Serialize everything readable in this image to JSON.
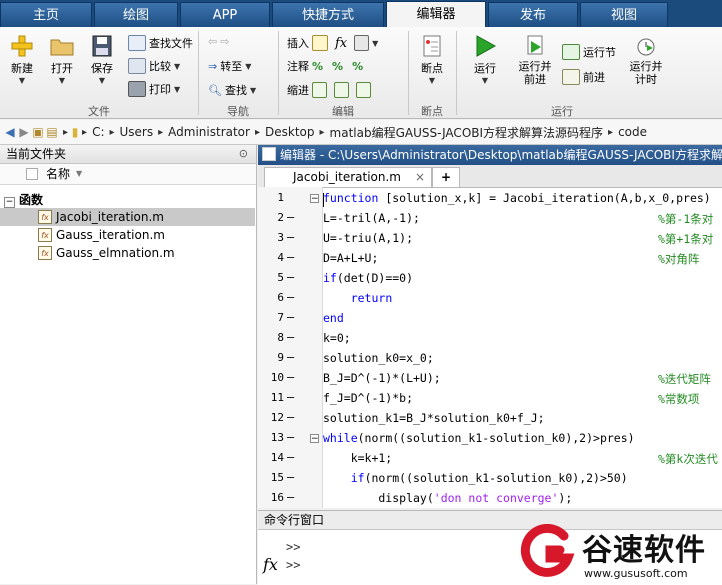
{
  "tabs": [
    "主页",
    "绘图",
    "APP",
    "快捷方式",
    "编辑器",
    "发布",
    "视图"
  ],
  "active_tab": "编辑器",
  "ribbon": {
    "file_group": {
      "label": "文件",
      "new": "新建",
      "open": "打开",
      "save": "保存",
      "find_files": "查找文件",
      "compare": "比较",
      "print": "打印"
    },
    "nav_group": {
      "label": "导航",
      "goto": "转至",
      "find": "查找"
    },
    "edit_group": {
      "label": "编辑",
      "insert": "插入",
      "comment": "注释",
      "indent": "缩进",
      "fx": "fx"
    },
    "breakpoint_group": {
      "label": "断点",
      "breakpoints": "断点"
    },
    "run_group": {
      "label": "运行",
      "run": "运行",
      "run_advance": "运行并\n前进",
      "run_section": "运行节",
      "advance": "前进",
      "run_time": "运行并\n计时"
    }
  },
  "address": [
    "C:",
    "Users",
    "Administrator",
    "Desktop",
    "matlab编程GAUSS-JACOBI方程求解算法源码程序",
    "code"
  ],
  "left_panel": {
    "title": "当前文件夹",
    "column": "名称",
    "group": "函数",
    "files": [
      "Jacobi_iteration.m",
      "Gauss_iteration.m",
      "Gauss_elmnation.m"
    ]
  },
  "editor": {
    "title": "编辑器 - C:\\Users\\Administrator\\Desktop\\matlab编程GAUSS-JACOBI方程求解",
    "tab": "Jacobi_iteration.m",
    "add_tab": "+",
    "lines": [
      {
        "n": "1",
        "text": "function [solution_x,k] = Jacobi_iteration(A,b,x_0,pres)",
        "comment": ""
      },
      {
        "n": "2",
        "text": "L=-tril(A,-1);",
        "comment": "%第-1条对"
      },
      {
        "n": "3",
        "text": "U=-triu(A,1);",
        "comment": "%第+1条对"
      },
      {
        "n": "4",
        "text": "D=A+L+U;",
        "comment": "%对角阵"
      },
      {
        "n": "5",
        "text": "if(det(D)==0)",
        "comment": ""
      },
      {
        "n": "6",
        "text": "    return",
        "comment": ""
      },
      {
        "n": "7",
        "text": "end",
        "comment": ""
      },
      {
        "n": "8",
        "text": "k=0;",
        "comment": ""
      },
      {
        "n": "9",
        "text": "solution_k0=x_0;",
        "comment": ""
      },
      {
        "n": "10",
        "text": "B_J=D^(-1)*(L+U);",
        "comment": "%迭代矩阵"
      },
      {
        "n": "11",
        "text": "f_J=D^(-1)*b;",
        "comment": "%常数项"
      },
      {
        "n": "12",
        "text": "solution_k1=B_J*solution_k0+f_J;",
        "comment": ""
      },
      {
        "n": "13",
        "text": "while(norm((solution_k1-solution_k0),2)>pres)",
        "comment": ""
      },
      {
        "n": "14",
        "text": "    k=k+1;",
        "comment": "%第k次迭代"
      },
      {
        "n": "15",
        "text": "    if(norm((solution_k1-solution_k0),2)>50)",
        "comment": ""
      },
      {
        "n": "16",
        "text": "        display('don not converge');",
        "comment": ""
      }
    ]
  },
  "command_window": {
    "title": "命令行窗口",
    "prompt1": ">>",
    "prompt2": ">>",
    "fx": "fx"
  },
  "watermark": {
    "brand": "谷速软件",
    "url": "www.gususoft.com"
  }
}
